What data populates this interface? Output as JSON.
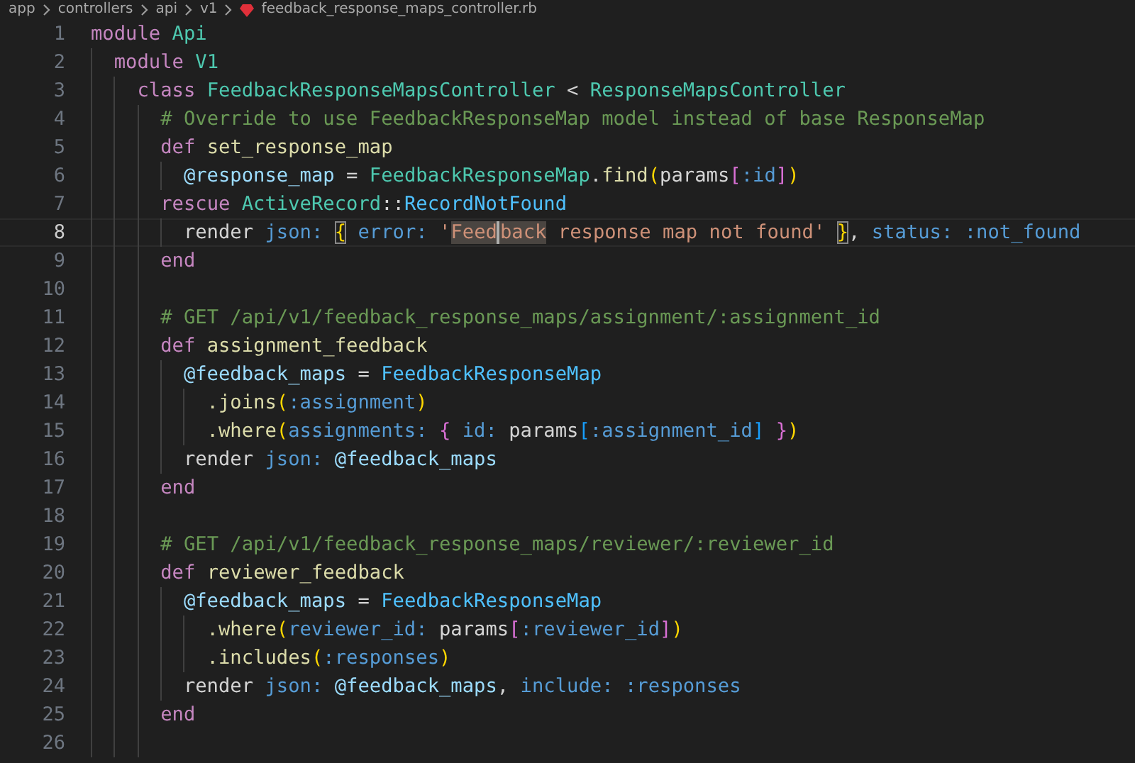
{
  "breadcrumb": {
    "segments": [
      "app",
      "controllers",
      "api",
      "v1"
    ],
    "file": "feedback_response_maps_controller.rb"
  },
  "lines": [
    {
      "n": "1",
      "current": false,
      "tokens": [
        {
          "kind": "kw",
          "text": "module "
        },
        {
          "kind": "type",
          "text": "Api"
        }
      ],
      "children": [
        {
          "n": "2",
          "current": false,
          "tokens": [
            {
              "kind": "kw",
              "text": "module "
            },
            {
              "kind": "type",
              "text": "V1"
            }
          ],
          "children": [
            {
              "n": "3",
              "current": false,
              "tokens": [
                {
                  "kind": "kw",
                  "text": "class "
                },
                {
                  "kind": "type",
                  "text": "FeedbackResponseMapsController"
                },
                {
                  "kind": "plain",
                  "text": " < "
                },
                {
                  "kind": "type",
                  "text": "ResponseMapsController"
                }
              ],
              "children": [
                {
                  "n": "4",
                  "current": false,
                  "tokens": [
                    {
                      "kind": "comment",
                      "text": "# Override to use FeedbackResponseMap model instead of base ResponseMap"
                    }
                  ]
                },
                {
                  "n": "5",
                  "current": false,
                  "tokens": [
                    {
                      "kind": "kw",
                      "text": "def "
                    },
                    {
                      "kind": "fn",
                      "text": "set_response_map"
                    }
                  ],
                  "children": [
                    {
                      "n": "6",
                      "current": false,
                      "tokens": [
                        {
                          "kind": "ivar",
                          "text": "@response_map"
                        },
                        {
                          "kind": "plain",
                          "text": " = "
                        },
                        {
                          "kind": "type",
                          "text": "FeedbackResponseMap"
                        },
                        {
                          "kind": "plain",
                          "text": "."
                        },
                        {
                          "kind": "fn",
                          "text": "find"
                        },
                        {
                          "kind": "b1",
                          "text": "("
                        },
                        {
                          "kind": "plain",
                          "text": "params"
                        },
                        {
                          "kind": "b2",
                          "text": "["
                        },
                        {
                          "kind": "key",
                          "text": ":id"
                        },
                        {
                          "kind": "b2",
                          "text": "]"
                        },
                        {
                          "kind": "b1",
                          "text": ")"
                        }
                      ]
                    }
                  ]
                },
                {
                  "n": "7",
                  "current": false,
                  "tokens": [
                    {
                      "kind": "kw",
                      "text": "rescue "
                    },
                    {
                      "kind": "type",
                      "text": "ActiveRecord"
                    },
                    {
                      "kind": "plain",
                      "text": "::"
                    },
                    {
                      "kind": "const",
                      "text": "RecordNotFound"
                    }
                  ],
                  "children": [
                    {
                      "n": "8",
                      "current": true,
                      "tokens": [
                        {
                          "kind": "plain",
                          "text": "render "
                        },
                        {
                          "kind": "key",
                          "text": "json: "
                        },
                        {
                          "kind": "b1",
                          "text": "{",
                          "matched": true
                        },
                        {
                          "kind": "key",
                          "text": " error: "
                        },
                        {
                          "kind": "str",
                          "text": "'"
                        },
                        {
                          "kind": "str",
                          "text": "Feed",
                          "highlight": true
                        },
                        {
                          "kind": "str",
                          "text": "back",
                          "highlight": true,
                          "caret": true
                        },
                        {
                          "kind": "str",
                          "text": " response map not found' "
                        },
                        {
                          "kind": "b1",
                          "text": "}",
                          "matched": true
                        },
                        {
                          "kind": "plain",
                          "text": ", "
                        },
                        {
                          "kind": "key",
                          "text": "status: :not_found"
                        }
                      ]
                    }
                  ]
                },
                {
                  "n": "9",
                  "current": false,
                  "tokens": [
                    {
                      "kind": "kw",
                      "text": "end"
                    }
                  ]
                },
                {
                  "n": "10",
                  "current": false
                },
                {
                  "n": "11",
                  "current": false,
                  "tokens": [
                    {
                      "kind": "comment",
                      "text": "# GET /api/v1/feedback_response_maps/assignment/:assignment_id"
                    }
                  ]
                },
                {
                  "n": "12",
                  "current": false,
                  "tokens": [
                    {
                      "kind": "kw",
                      "text": "def "
                    },
                    {
                      "kind": "fn",
                      "text": "assignment_feedback"
                    }
                  ],
                  "children": [
                    {
                      "n": "13",
                      "current": false,
                      "tokens": [
                        {
                          "kind": "ivar",
                          "text": "@feedback_maps"
                        },
                        {
                          "kind": "plain",
                          "text": " = "
                        },
                        {
                          "kind": "const",
                          "text": "FeedbackResponseMap"
                        }
                      ],
                      "children": [
                        {
                          "n": "14",
                          "current": false,
                          "tokens": [
                            {
                              "kind": "fn",
                              "text": ".joins"
                            },
                            {
                              "kind": "b1",
                              "text": "("
                            },
                            {
                              "kind": "key",
                              "text": ":assignment"
                            },
                            {
                              "kind": "b1",
                              "text": ")"
                            }
                          ]
                        },
                        {
                          "n": "15",
                          "current": false,
                          "tokens": [
                            {
                              "kind": "fn",
                              "text": ".where"
                            },
                            {
                              "kind": "b1",
                              "text": "("
                            },
                            {
                              "kind": "key",
                              "text": "assignments: "
                            },
                            {
                              "kind": "b2",
                              "text": "{"
                            },
                            {
                              "kind": "key",
                              "text": " id: "
                            },
                            {
                              "kind": "plain",
                              "text": "params"
                            },
                            {
                              "kind": "b3",
                              "text": "["
                            },
                            {
                              "kind": "key",
                              "text": ":assignment_id"
                            },
                            {
                              "kind": "b3",
                              "text": "] "
                            },
                            {
                              "kind": "b2",
                              "text": "}"
                            },
                            {
                              "kind": "b1",
                              "text": ")"
                            }
                          ]
                        }
                      ]
                    },
                    {
                      "n": "16",
                      "current": false,
                      "tokens": [
                        {
                          "kind": "plain",
                          "text": "render "
                        },
                        {
                          "kind": "key",
                          "text": "json: "
                        },
                        {
                          "kind": "ivar",
                          "text": "@feedback_maps"
                        }
                      ]
                    }
                  ]
                },
                {
                  "n": "17",
                  "current": false,
                  "tokens": [
                    {
                      "kind": "kw",
                      "text": "end"
                    }
                  ]
                },
                {
                  "n": "18",
                  "current": false
                },
                {
                  "n": "19",
                  "current": false,
                  "tokens": [
                    {
                      "kind": "comment",
                      "text": "# GET /api/v1/feedback_response_maps/reviewer/:reviewer_id"
                    }
                  ]
                },
                {
                  "n": "20",
                  "current": false,
                  "tokens": [
                    {
                      "kind": "kw",
                      "text": "def "
                    },
                    {
                      "kind": "fn",
                      "text": "reviewer_feedback"
                    }
                  ],
                  "children": [
                    {
                      "n": "21",
                      "current": false,
                      "tokens": [
                        {
                          "kind": "ivar",
                          "text": "@feedback_maps"
                        },
                        {
                          "kind": "plain",
                          "text": " = "
                        },
                        {
                          "kind": "const",
                          "text": "FeedbackResponseMap"
                        }
                      ],
                      "children": [
                        {
                          "n": "22",
                          "current": false,
                          "tokens": [
                            {
                              "kind": "fn",
                              "text": ".where"
                            },
                            {
                              "kind": "b1",
                              "text": "("
                            },
                            {
                              "kind": "key",
                              "text": "reviewer_id: "
                            },
                            {
                              "kind": "plain",
                              "text": "params"
                            },
                            {
                              "kind": "b2",
                              "text": "["
                            },
                            {
                              "kind": "key",
                              "text": ":reviewer_id"
                            },
                            {
                              "kind": "b2",
                              "text": "]"
                            },
                            {
                              "kind": "b1",
                              "text": ")"
                            }
                          ]
                        },
                        {
                          "n": "23",
                          "current": false,
                          "tokens": [
                            {
                              "kind": "fn",
                              "text": ".includes"
                            },
                            {
                              "kind": "b1",
                              "text": "("
                            },
                            {
                              "kind": "key",
                              "text": ":responses"
                            },
                            {
                              "kind": "b1",
                              "text": ")"
                            }
                          ]
                        }
                      ]
                    },
                    {
                      "n": "24",
                      "current": false,
                      "tokens": [
                        {
                          "kind": "plain",
                          "text": "render "
                        },
                        {
                          "kind": "key",
                          "text": "json: "
                        },
                        {
                          "kind": "ivar",
                          "text": "@feedback_maps"
                        },
                        {
                          "kind": "plain",
                          "text": ", "
                        },
                        {
                          "kind": "key",
                          "text": "include: :responses"
                        }
                      ]
                    }
                  ]
                },
                {
                  "n": "25",
                  "current": false,
                  "tokens": [
                    {
                      "kind": "kw",
                      "text": "end"
                    }
                  ]
                },
                {
                  "n": "26",
                  "current": false
                }
              ]
            }
          ]
        }
      ]
    }
  ]
}
